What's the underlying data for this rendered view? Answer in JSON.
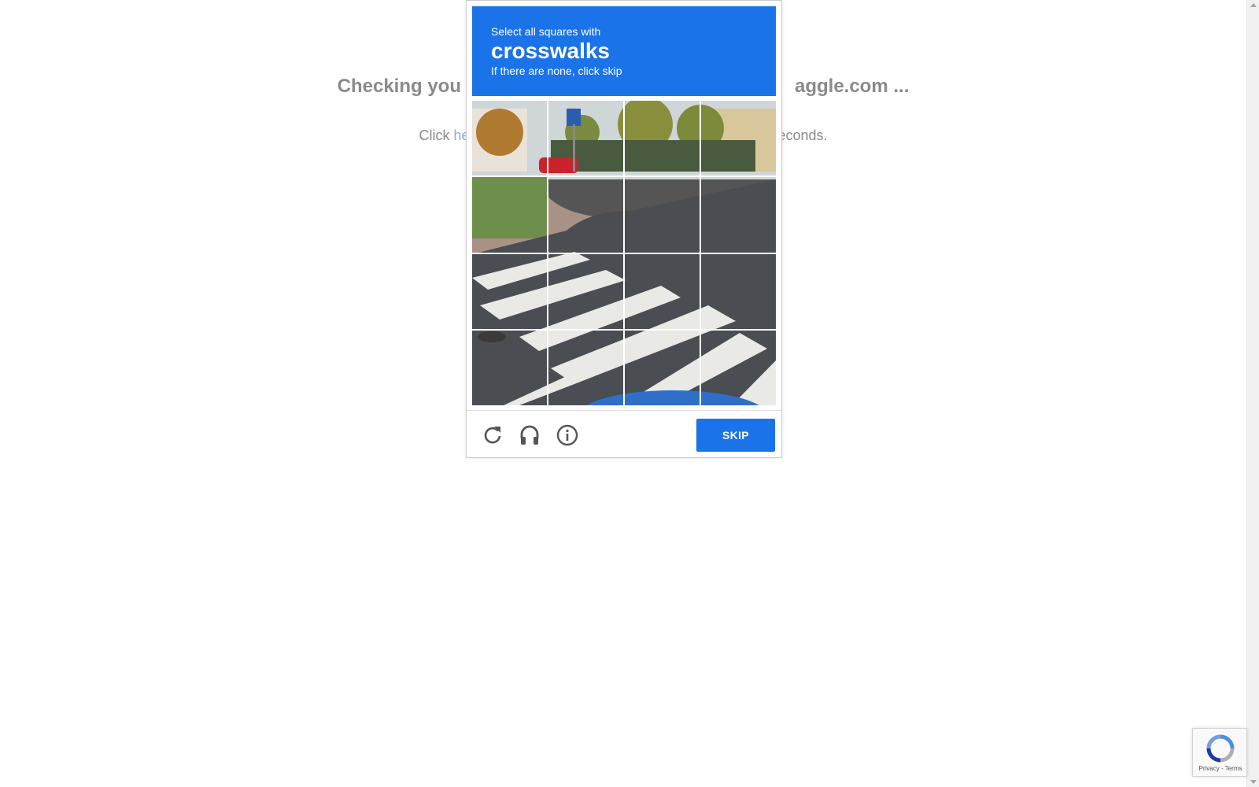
{
  "background": {
    "heading_left": "Checking you",
    "heading_right": "aggle.com ...",
    "sub_left": "Click ",
    "sub_link": "he",
    "sub_right": "econds."
  },
  "challenge": {
    "instruction_line1": "Select all squares with",
    "target": "crosswalks",
    "instruction_line3": "If there are none, click skip",
    "grid": {
      "rows": 4,
      "columns": 4
    },
    "footer": {
      "reload_icon": "reload-icon",
      "audio_icon": "headphones-icon",
      "info_icon": "info-icon",
      "skip_label": "SKIP"
    },
    "colors": {
      "header": "#1a73e8",
      "button": "#1a73e8"
    }
  },
  "badge": {
    "links": "Privacy - Terms",
    "icon": "recaptcha-logo-icon"
  }
}
